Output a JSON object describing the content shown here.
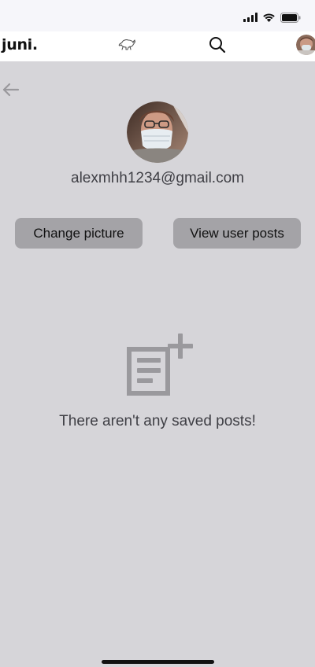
{
  "app": {
    "brand": "juni."
  },
  "nav": {
    "logo_icon": "bull-icon",
    "search_icon": "search-icon",
    "avatar_icon": "profile-avatar-icon"
  },
  "profile": {
    "email": "alexmhh1234@gmail.com",
    "buttons": {
      "change_picture": "Change picture",
      "view_user_posts": "View user posts"
    }
  },
  "empty_state": {
    "icon": "add-post-icon",
    "message": "There aren't any saved posts!"
  },
  "colors": {
    "background": "#d6d5d9",
    "button": "#a4a3a7",
    "icon_gray": "#9a999d",
    "text": "#3f3f45"
  }
}
